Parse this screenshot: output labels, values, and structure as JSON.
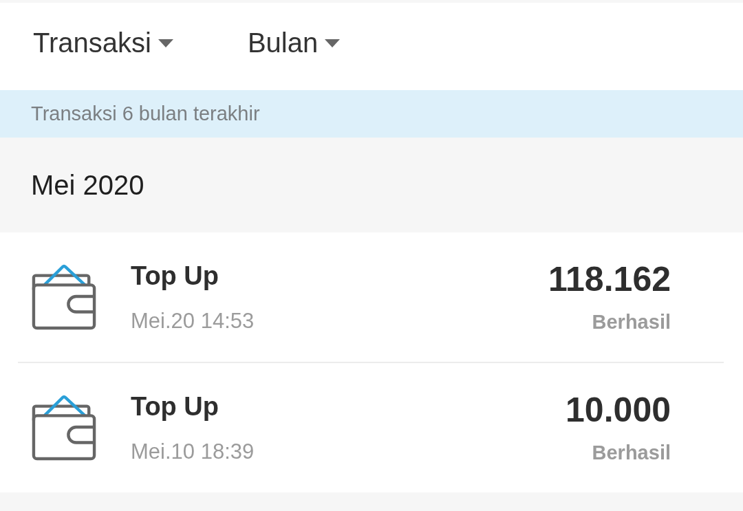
{
  "filters": [
    {
      "label": "Transaksi"
    },
    {
      "label": "Bulan"
    }
  ],
  "notice": "Transaksi 6 bulan terakhir",
  "month_header": "Mei 2020",
  "transactions": [
    {
      "title": "Top Up",
      "datetime": "Mei.20 14:53",
      "amount": "118.162",
      "status": "Berhasil"
    },
    {
      "title": "Top Up",
      "datetime": "Mei.10 18:39",
      "amount": "10.000",
      "status": "Berhasil"
    }
  ]
}
